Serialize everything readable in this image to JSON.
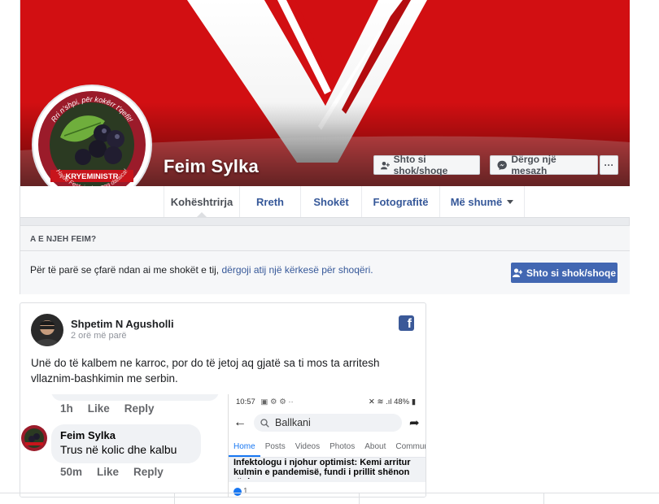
{
  "profile": {
    "name": "Feim Sylka",
    "add_friend_label": "Shto si shok/shoqe",
    "message_label": "Dërgo një mesazh",
    "more_label": "···",
    "badge_text": "KRYEMINISTR",
    "ring_text_top": "Rri n'shpi, për kokërr t'qefit!",
    "ring_text_bottom": "Hajde Fest, ju don nga dataica!",
    "colors": {
      "cover_red": "#d20f12",
      "link_blue": "#365899",
      "primary_blue": "#4267b2"
    }
  },
  "tabs": [
    {
      "label": "Kohështrirja",
      "active": true
    },
    {
      "label": "Rreth"
    },
    {
      "label": "Shokët"
    },
    {
      "label": "Fotografitë"
    },
    {
      "label": "Më shumë"
    }
  ],
  "know": {
    "header": "A E NJEH FEIM?",
    "text": "Për të parë se çfarë ndan ai me shokët e tij,",
    "link": "dërgoji atij një kërkesë për shoqëri.",
    "button": "Shto si shok/shoqe"
  },
  "post": {
    "author": "Shpetim N Agusholli",
    "time": "2 orë më parë",
    "text": "Unë do të kalbem ne karroc, por do të jetoj aq gjatë sa ti mos ta arritesh vllaznim-bashkimin me serbin.",
    "source_icon": "facebook-icon",
    "embedded_comment": {
      "prev_time": "1h",
      "prev_like": "Like",
      "prev_reply": "Reply",
      "name": "Feim Sylka",
      "text": "Trus në kolic dhe kalbu",
      "time": "50m",
      "like": "Like",
      "reply": "Reply"
    },
    "embedded_phone": {
      "clock": "10:57",
      "battery": "48%",
      "search_value": "Ballkani",
      "tabs": [
        "Home",
        "Posts",
        "Videos",
        "Photos",
        "About",
        "Commun"
      ],
      "headline": "Infektologu i njohur optimist: Kemi arritur kulmin e pandemisë, fundi i prillit shënon rënie...",
      "reaction_count": "1"
    }
  }
}
